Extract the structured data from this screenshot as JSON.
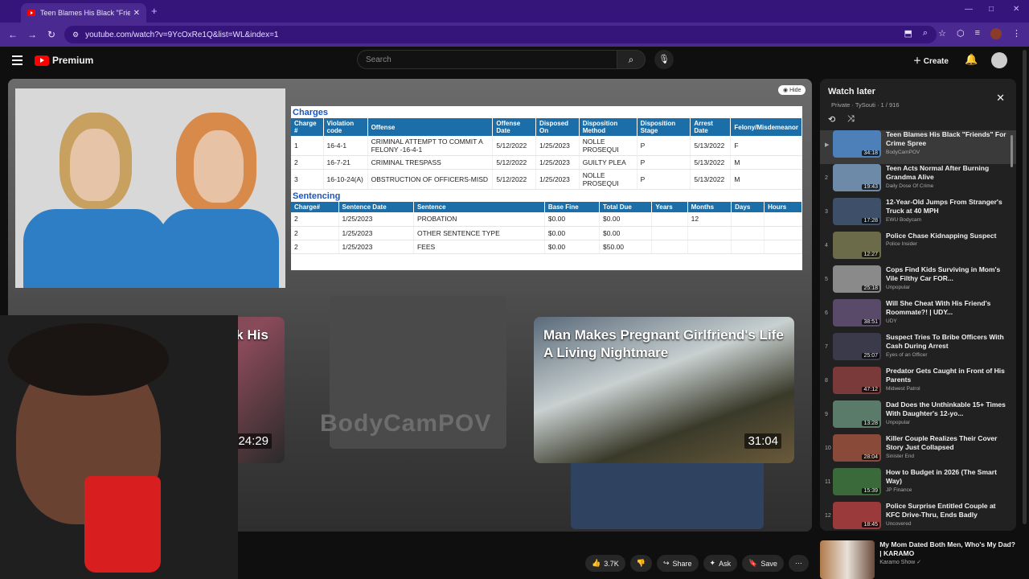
{
  "browser": {
    "tab_title": "Teen Blames His Black \"Friends\"",
    "url": "youtube.com/watch?v=9YcOxRe1Q&list=WL&index=1"
  },
  "header": {
    "logo_text": "Premium",
    "search_placeholder": "Search",
    "create_label": "Create"
  },
  "player": {
    "hide_label": "Hide",
    "watermark": "BodyCamPOV",
    "charges": {
      "heading": "Charges",
      "columns": [
        "Charge #",
        "Violation code",
        "Offense",
        "Offense Date",
        "Disposed On",
        "Disposition Method",
        "Disposition Stage",
        "Arrest Date",
        "Felony/Misdemeanor"
      ],
      "rows": [
        [
          "1",
          "16-4-1",
          "CRIMINAL ATTEMPT TO COMMIT A FELONY -16-4-1",
          "5/12/2022",
          "1/25/2023",
          "NOLLE PROSEQUI",
          "P",
          "5/13/2022",
          "F"
        ],
        [
          "2",
          "16-7-21",
          "CRIMINAL TRESPASS",
          "5/12/2022",
          "1/25/2023",
          "GUILTY PLEA",
          "P",
          "5/13/2022",
          "M"
        ],
        [
          "3",
          "16-10-24(A)",
          "OBSTRUCTION OF OFFICERS-MISD",
          "5/12/2022",
          "1/25/2023",
          "NOLLE PROSEQUI",
          "P",
          "5/13/2022",
          "M"
        ]
      ]
    },
    "sentencing": {
      "heading": "Sentencing",
      "columns": [
        "Charge#",
        "Sentence Date",
        "Sentence",
        "Base Fine",
        "Total Due",
        "Years",
        "Months",
        "Days",
        "Hours"
      ],
      "rows": [
        [
          "2",
          "1/25/2023",
          "PROBATION",
          "$0.00",
          "$0.00",
          "",
          "12",
          "",
          ""
        ],
        [
          "2",
          "1/25/2023",
          "OTHER SENTENCE TYPE",
          "$0.00",
          "$0.00",
          "",
          "",
          "",
          ""
        ],
        [
          "2",
          "1/25/2023",
          "FEES",
          "$0.00",
          "$50.00",
          "",
          "",
          "",
          ""
        ]
      ]
    },
    "endcards": [
      {
        "title": "Old Son tries To Kick His ... Out Of Her Own...",
        "duration": "24:29"
      },
      {
        "title": "Man Makes Pregnant Girlfriend's Life A Living Nightmare",
        "duration": "31:04"
      }
    ]
  },
  "actions": {
    "like_count": "3.7K",
    "share_label": "Share",
    "ask_label": "Ask",
    "save_label": "Save"
  },
  "playlist": {
    "title": "Watch later",
    "subtitle": "Private · TySouti · 1 / 916",
    "items": [
      {
        "index": "",
        "title": "Teen Blames His Black \"Friends\" For Crime Spree",
        "channel": "BodyCamPOV",
        "duration": "34:18",
        "color": "#4d7fb8"
      },
      {
        "index": "2",
        "title": "Teen Acts Normal After Burning Grandma Alive",
        "channel": "Daily Dose Of Crime",
        "duration": "19:43",
        "color": "#6d8aa8"
      },
      {
        "index": "3",
        "title": "12-Year-Old Jumps From Stranger's Truck at 40 MPH",
        "channel": "EWU Bodycam",
        "duration": "17:28",
        "color": "#3e4f6a"
      },
      {
        "index": "4",
        "title": "Police Chase Kidnapping Suspect",
        "channel": "Police Insider",
        "duration": "12:27",
        "color": "#6b6b4a"
      },
      {
        "index": "5",
        "title": "Cops Find Kids Surviving in Mom's Vile Filthy Car FOR...",
        "channel": "Unpopular",
        "duration": "25:18",
        "color": "#8a8a8a"
      },
      {
        "index": "6",
        "title": "Will She Cheat With His Friend's Roommate?! | UDY...",
        "channel": "UDY",
        "duration": "38:51",
        "color": "#5a4a6a"
      },
      {
        "index": "7",
        "title": "Suspect Tries To Bribe Officers With Cash During Arrest",
        "channel": "Eyes of an Officer",
        "duration": "25:07",
        "color": "#3a3a4a"
      },
      {
        "index": "8",
        "title": "Predator Gets Caught in Front of His Parents",
        "channel": "Midwest Patrol",
        "duration": "47:12",
        "color": "#7a3a3a"
      },
      {
        "index": "9",
        "title": "Dad Does the Unthinkable 15+ Times With Daughter's 12-yo...",
        "channel": "Unpopular",
        "duration": "13:28",
        "color": "#5a7a6a"
      },
      {
        "index": "10",
        "title": "Killer Couple Realizes Their Cover Story Just Collapsed",
        "channel": "Sinister End",
        "duration": "28:04",
        "color": "#8a4a3a"
      },
      {
        "index": "11",
        "title": "How to Budget in 2026 (The Smart Way)",
        "channel": "JP Finance",
        "duration": "15:39",
        "color": "#3a6a3a"
      },
      {
        "index": "12",
        "title": "Police Surprise Entitled Couple at KFC Drive-Thru, Ends Badly",
        "channel": "Uncovered",
        "duration": "18:45",
        "color": "#9a3a3a"
      }
    ]
  },
  "next_video": {
    "title": "My Mom Dated Both Men, Who's My Dad? | KARAMO",
    "channel": "Karamo Show ✓"
  }
}
